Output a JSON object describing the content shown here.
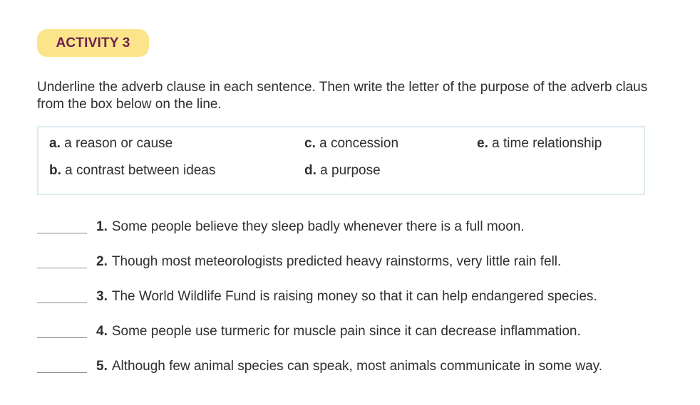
{
  "activity": {
    "label": "ACTIVITY 3"
  },
  "instructions": {
    "text": "Underline the adverb clause in each sentence. Then write the letter of the purpose of the adverb claus\nfrom the box below on the line."
  },
  "options": [
    {
      "letter": "a.",
      "text": "a reason or cause"
    },
    {
      "letter": "b.",
      "text": "a contrast between ideas"
    },
    {
      "letter": "c.",
      "text": "a concession"
    },
    {
      "letter": "d.",
      "text": "a purpose"
    },
    {
      "letter": "e.",
      "text": "a time relationship"
    }
  ],
  "exercises": [
    {
      "number": "1.",
      "text": "Some people believe they sleep badly whenever there is a full moon."
    },
    {
      "number": "2.",
      "text": "Though most meteorologists predicted heavy rainstorms, very little rain fell."
    },
    {
      "number": "3.",
      "text": "The World Wildlife Fund is raising money so that it can help endangered species."
    },
    {
      "number": "4.",
      "text": "Some people use turmeric for muscle pain since it can decrease inflammation."
    },
    {
      "number": "5.",
      "text": "Although few animal species can speak, most animals communicate in some way."
    }
  ],
  "colors": {
    "badge_background": "#fbe48a",
    "badge_text": "#6b1f4d",
    "box_border": "#dcecf0"
  }
}
